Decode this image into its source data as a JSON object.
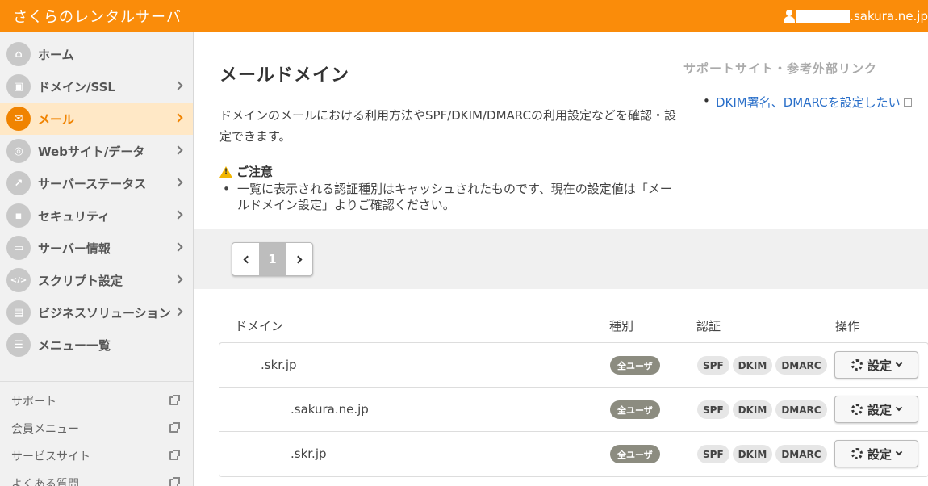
{
  "header": {
    "brand": "さくらのレンタルサーバ",
    "account_suffix": ".sakura.ne.jp"
  },
  "sidebar": {
    "items": [
      {
        "label": "ホーム",
        "icon": "home-icon",
        "glyph": "⌂"
      },
      {
        "label": "ドメイン/SSL",
        "icon": "domain-lock-icon",
        "glyph": "▣"
      },
      {
        "label": "メール",
        "icon": "mail-icon",
        "glyph": "✉"
      },
      {
        "label": "Webサイト/データ",
        "icon": "globe-icon",
        "glyph": "◎"
      },
      {
        "label": "サーバーステータス",
        "icon": "chart-icon",
        "glyph": "↗"
      },
      {
        "label": "セキュリティ",
        "icon": "lock-icon",
        "glyph": "▪"
      },
      {
        "label": "サーバー情報",
        "icon": "server-icon",
        "glyph": "▭"
      },
      {
        "label": "スクリプト設定",
        "icon": "script-icon",
        "glyph": "</>"
      },
      {
        "label": "ビジネスソリューション",
        "icon": "briefcase-icon",
        "glyph": "▤"
      },
      {
        "label": "メニュー一覧",
        "icon": "list-icon",
        "glyph": "☰"
      }
    ],
    "links": [
      {
        "label": "サポート"
      },
      {
        "label": "会員メニュー"
      },
      {
        "label": "サービスサイト"
      },
      {
        "label": "よくある質問"
      }
    ]
  },
  "main": {
    "title": "メールドメイン",
    "description": "ドメインのメールにおける利用方法やSPF/DKIM/DMARCの利用設定などを確認・設定できます。",
    "caution_title": "ご注意",
    "caution_text": "一覧に表示される認証種別はキャッシュされたものです、現在の設定値は「メールドメイン設定」よりご確認ください。",
    "support_heading": "サポートサイト・参考外部リンク",
    "support_link": "DKIM署名、DMARCを設定したい",
    "pager": {
      "current": "1"
    },
    "table": {
      "headers": {
        "domain": "ドメイン",
        "type": "種別",
        "auth": "認証",
        "action": "操作"
      },
      "rows": [
        {
          "domain": ".skr.jp",
          "type": "全ユーザ",
          "auth": [
            "SPF",
            "DKIM",
            "DMARC"
          ],
          "action": "設定"
        },
        {
          "domain": ".sakura.ne.jp",
          "type": "全ユーザ",
          "auth": [
            "SPF",
            "DKIM",
            "DMARC"
          ],
          "action": "設定"
        },
        {
          "domain": ".skr.jp",
          "type": "全ユーザ",
          "auth": [
            "SPF",
            "DKIM",
            "DMARC"
          ],
          "action": "設定"
        }
      ]
    }
  },
  "colors": {
    "brand": "#fa8c0a",
    "active_bg": "#ffe8c6",
    "accent": "#f08300",
    "link": "#2a6fc9"
  }
}
